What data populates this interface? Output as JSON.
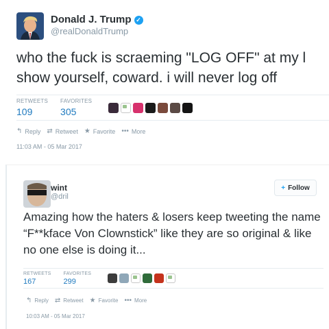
{
  "tweet1": {
    "author": {
      "name": "Donald J. Trump",
      "handle": "@realDonaldTrump",
      "verified_icon": "verified-badge-icon"
    },
    "text": "who the fuck is scraeming \"LOG OFF\" at my l\nshow yourself, coward. i will never log off",
    "stats": {
      "retweets_label": "RETWEETS",
      "retweets": "109",
      "favorites_label": "FAVORITES",
      "favorites": "305"
    },
    "actions": {
      "reply": "Reply",
      "retweet": "Retweet",
      "favorite": "Favorite",
      "more": "More"
    },
    "timestamp": "11:03 AM - 05 Mar 2017"
  },
  "tweet2": {
    "author": {
      "name": "wint",
      "handle": "@dril"
    },
    "follow_label": "Follow",
    "text": "Amazing how the haters & losers keep tweeting the name “F**kface Von Clownstick” like they are so original & like no one else is doing it...",
    "stats": {
      "retweets_label": "RETWEETS",
      "retweets": "167",
      "favorites_label": "FAVORITES",
      "favorites": "299"
    },
    "actions": {
      "reply": "Reply",
      "retweet": "Retweet",
      "favorite": "Favorite",
      "more": "More"
    },
    "timestamp": "10:03 AM - 05 Mar 2017"
  },
  "colors": {
    "link_blue": "#1f7abf",
    "twitter_blue": "#1da1f2",
    "muted_gray": "#8899a6",
    "text_dark": "#292f33"
  }
}
